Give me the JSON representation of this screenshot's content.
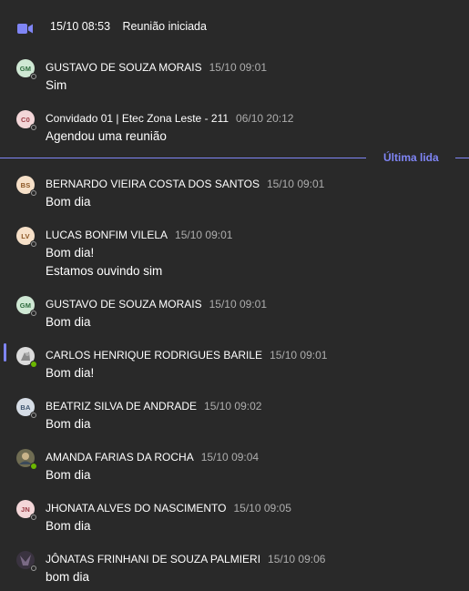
{
  "meeting": {
    "time": "15/10 08:53",
    "text": "Reunião iniciada",
    "icon": "video-camera-icon",
    "accent": "#7f85f5"
  },
  "divider_label": "Última lida",
  "messages": [
    {
      "initials": "GM",
      "avatar_bg": "#cfe8d4",
      "avatar_fg": "#2e6b3d",
      "status": "offline",
      "sender": "GUSTAVO DE SOUZA MORAIS",
      "time": "15/10 09:01",
      "lines": [
        "Sim"
      ]
    },
    {
      "initials": "C0",
      "avatar_bg": "#f3d6d8",
      "avatar_fg": "#9a3b44",
      "status": "offline",
      "sender": "Convidado 01 | Etec Zona Leste - 211",
      "time": "06/10 20:12",
      "lines": [
        "Agendou uma reunião"
      ]
    },
    {
      "initials": "BS",
      "avatar_bg": "#f6e0c8",
      "avatar_fg": "#8a5522",
      "status": "offline",
      "sender": "BERNARDO VIEIRA COSTA DOS SANTOS",
      "time": "15/10 09:01",
      "lines": [
        "Bom dia"
      ]
    },
    {
      "initials": "LV",
      "avatar_bg": "#f6e0c8",
      "avatar_fg": "#8a5522",
      "status": "offline",
      "sender": "LUCAS BONFIM VILELA",
      "time": "15/10 09:01",
      "lines": [
        "Bom dia!",
        "Estamos ouvindo sim"
      ]
    },
    {
      "initials": "GM",
      "avatar_bg": "#cfe8d4",
      "avatar_fg": "#2e6b3d",
      "status": "offline",
      "sender": "GUSTAVO DE SOUZA MORAIS",
      "time": "15/10 09:01",
      "lines": [
        "Bom dia"
      ]
    },
    {
      "initials": "",
      "avatar_bg": "#d8d8d8",
      "avatar_fg": "#555555",
      "photo": true,
      "status": "online",
      "sender": "CARLOS HENRIQUE RODRIGUES BARILE",
      "time": "15/10 09:01",
      "lines": [
        "Bom dia!"
      ]
    },
    {
      "initials": "BA",
      "avatar_bg": "#d6dde6",
      "avatar_fg": "#3f5670",
      "status": "offline",
      "sender": "BEATRIZ SILVA DE ANDRADE",
      "time": "15/10 09:02",
      "lines": [
        "Bom dia"
      ]
    },
    {
      "initials": "",
      "avatar_bg": "#8c8a6a",
      "avatar_fg": "#ffffff",
      "photo": true,
      "status": "online",
      "sender": "AMANDA FARIAS DA ROCHA",
      "time": "15/10 09:04",
      "lines": [
        "Bom dia"
      ]
    },
    {
      "initials": "JN",
      "avatar_bg": "#f3d6d8",
      "avatar_fg": "#9a3b44",
      "status": "offline",
      "sender": "JHONATA ALVES DO NASCIMENTO",
      "time": "15/10 09:05",
      "lines": [
        "Bom dia"
      ]
    },
    {
      "initials": "",
      "avatar_bg": "#4a3f4a",
      "avatar_fg": "#ffffff",
      "photo": true,
      "status": "offline",
      "sender": "JÔNATAS FRINHANI DE SOUZA PALMIERI",
      "time": "15/10 09:06",
      "lines": [
        "bom dia"
      ]
    }
  ]
}
